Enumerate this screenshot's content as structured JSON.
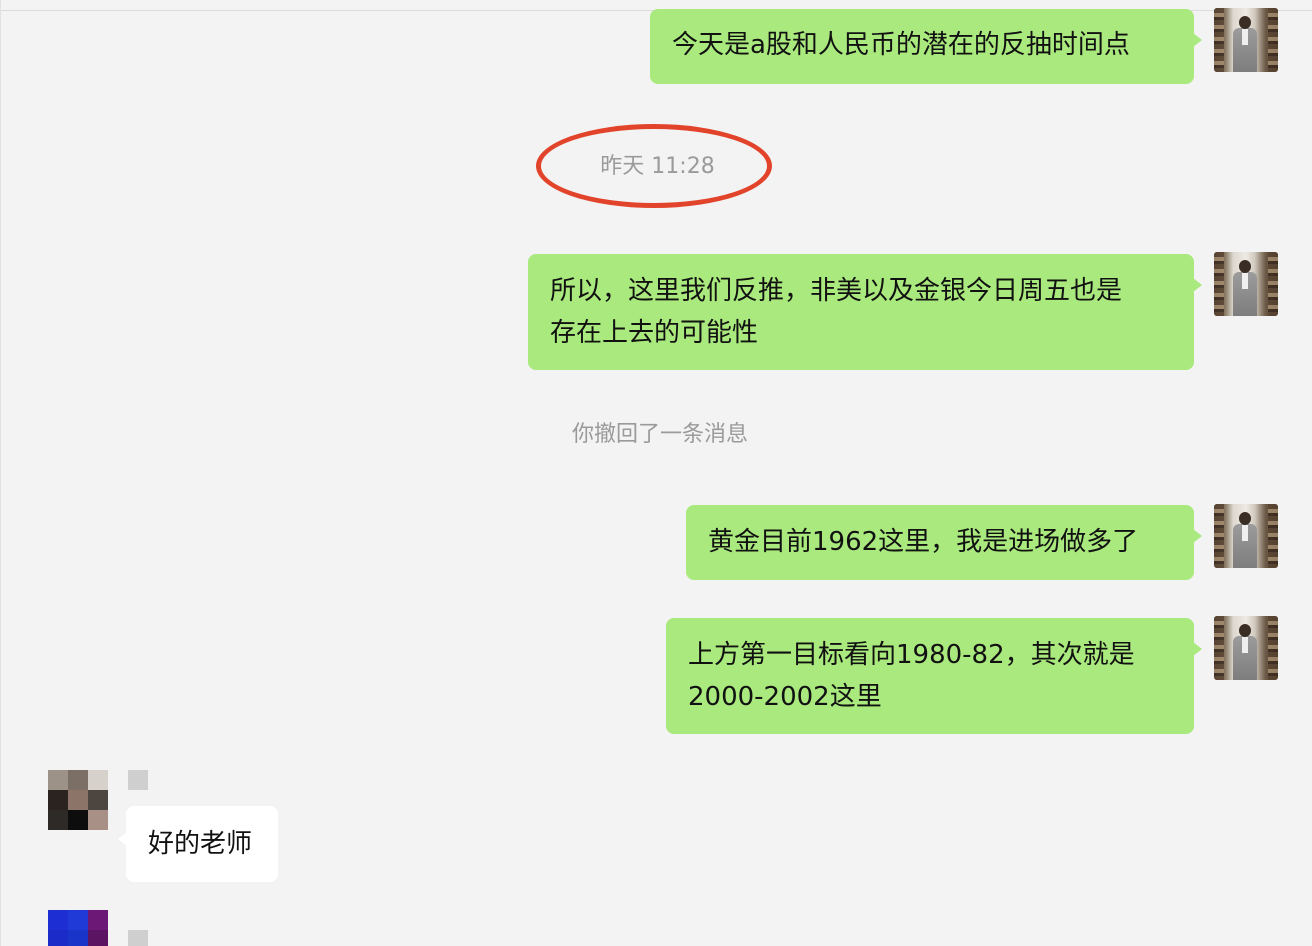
{
  "conversation": {
    "messages": [
      {
        "sender": "self",
        "text": "今天是a股和人民币的潜在的反抽时间点"
      },
      {
        "type": "timestamp",
        "text": "昨天 11:28"
      },
      {
        "sender": "self",
        "lines": [
          "所以，这里我们反推，非美以及金银今日周五也是",
          "存在上去的可能性"
        ]
      },
      {
        "type": "system",
        "text": "你撤回了一条消息"
      },
      {
        "sender": "self",
        "text": "黄金目前1962这里，我是进场做多了"
      },
      {
        "sender": "self",
        "lines": [
          "上方第一目标看向1980-82，其次就是",
          "2000-2002这里"
        ]
      },
      {
        "sender": "contact",
        "text": "好的老师"
      }
    ]
  },
  "colors": {
    "background": "#f3f3f3",
    "outgoing_bubble": "#a9e97d",
    "incoming_bubble": "#ffffff",
    "annotation_ring": "#e2442b",
    "system_text": "#9a9a9a"
  },
  "avatars": {
    "contact_1_pixels": [
      "#9c9288",
      "#7b6f66",
      "#d6d1cb",
      "#2a2320",
      "#8c7468",
      "#4d4540",
      "#2e2a28",
      "#0d0d0d",
      "#a89087"
    ],
    "contact_2_pixels": [
      "#1d2fd2",
      "#1f3ad6",
      "#6b1877",
      "#1b2bc7",
      "#1834c9",
      "#5a1461",
      "#1a2ac0",
      "#1731c3",
      "#561058"
    ]
  }
}
